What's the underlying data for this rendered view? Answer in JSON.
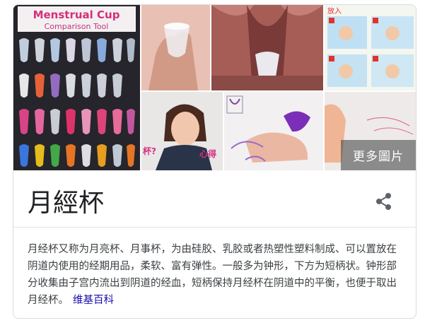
{
  "panel": {
    "title": "月經杯",
    "more_images_label": "更多圖片",
    "description": "月经杯又称为月亮杯、月事杯，为由硅胶、乳胶或者热塑性塑料制成、可以置放在阴道内使用的经期用品，柔软、富有弹性。一般多为钟形，下方为短柄状。钟形部分收集由子宫内流出到阴道的经血，短柄保持月经杯在阴道中的平衡，也便于取出月经杯。",
    "source_link": "维基百科",
    "share_icon": "share-icon"
  },
  "images": {
    "tile1": {
      "heading_line1": "Menstrual Cup",
      "heading_line2": "Comparison Tool"
    },
    "tile4": {
      "label": "放入"
    },
    "tile5": {
      "label_left": "杯?",
      "label_right": "心得"
    }
  },
  "colors": {
    "link": "#1a0dab",
    "title": "#202124",
    "text": "#3c4043",
    "border": "#dadce0"
  }
}
